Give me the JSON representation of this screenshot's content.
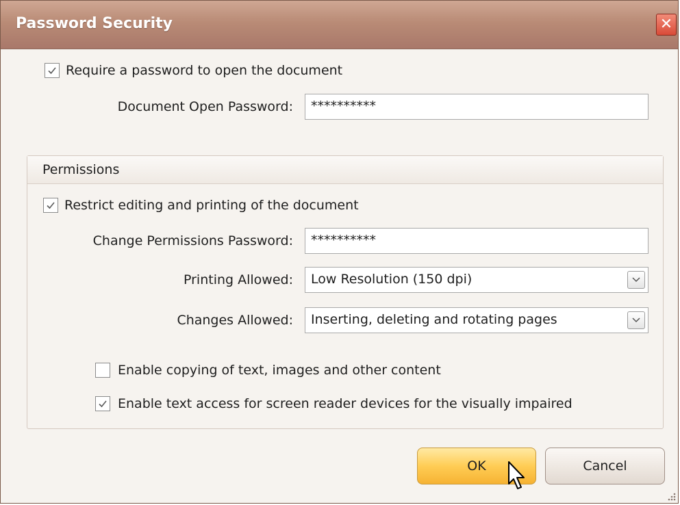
{
  "dialog": {
    "title": "Password Security",
    "close_symbol": "✕"
  },
  "open_password": {
    "checkbox_label": "Require a password to open the document",
    "checked": true,
    "field_label": "Document Open Password:",
    "value": "**********"
  },
  "permissions": {
    "group_title": "Permissions",
    "restrict_label": "Restrict editing and printing of the document",
    "restrict_checked": true,
    "change_password_label": "Change Permissions Password:",
    "change_password_value": "**********",
    "printing_label": "Printing Allowed:",
    "printing_value": "Low Resolution (150 dpi)",
    "changes_label": "Changes Allowed:",
    "changes_value": "Inserting, deleting and rotating pages",
    "copy_label": "Enable copying of text, images and other content",
    "copy_checked": false,
    "screen_reader_label": "Enable text access for screen reader devices for the visually impaired",
    "screen_reader_checked": true
  },
  "buttons": {
    "ok": "OK",
    "cancel": "Cancel"
  },
  "icons": [
    "close-icon",
    "checkmark-icon",
    "chevron-down-icon",
    "mouse-pointer-icon",
    "resize-grip-icon"
  ],
  "colors": {
    "titlebar": "#b98b76",
    "ok_button": "#ffcd55",
    "close_button": "#d94b38"
  }
}
